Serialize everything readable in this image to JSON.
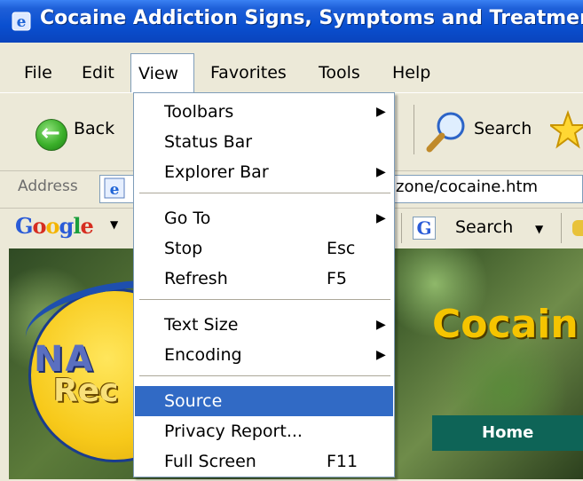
{
  "window": {
    "title": "Cocaine Addiction Signs, Symptoms and Treatment"
  },
  "menubar": {
    "items": [
      "File",
      "Edit",
      "View",
      "Favorites",
      "Tools",
      "Help"
    ]
  },
  "toolbar": {
    "back_label": "Back",
    "search_label": "Search"
  },
  "address": {
    "label": "Address",
    "url_partial": "zone/cocaine.htm"
  },
  "googlebar": {
    "brand": "Google",
    "search_label": "Search"
  },
  "view_menu": {
    "groups": [
      [
        {
          "label": "Toolbars",
          "shortcut": "",
          "submenu": true
        },
        {
          "label": "Status Bar",
          "shortcut": "",
          "submenu": false
        },
        {
          "label": "Explorer Bar",
          "shortcut": "",
          "submenu": true
        }
      ],
      [
        {
          "label": "Go To",
          "shortcut": "",
          "submenu": true
        },
        {
          "label": "Stop",
          "shortcut": "Esc",
          "submenu": false
        },
        {
          "label": "Refresh",
          "shortcut": "F5",
          "submenu": false
        }
      ],
      [
        {
          "label": "Text Size",
          "shortcut": "",
          "submenu": true
        },
        {
          "label": "Encoding",
          "shortcut": "",
          "submenu": true
        }
      ],
      [
        {
          "label": "Source",
          "shortcut": "",
          "submenu": false,
          "highlighted": true
        },
        {
          "label": "Privacy Report...",
          "shortcut": "",
          "submenu": false
        },
        {
          "label": "Full Screen",
          "shortcut": "F11",
          "submenu": false
        }
      ]
    ]
  },
  "page": {
    "logo_text_top": "NA",
    "logo_text_bottom": "Rec",
    "heading": "Cocain",
    "home_link": "Home"
  },
  "colors": {
    "titlebar": "#0a4fd0",
    "chrome": "#ece9d8",
    "menu_highlight": "#316ac5",
    "heading": "#f5c400",
    "home_tab": "#0e6457"
  }
}
